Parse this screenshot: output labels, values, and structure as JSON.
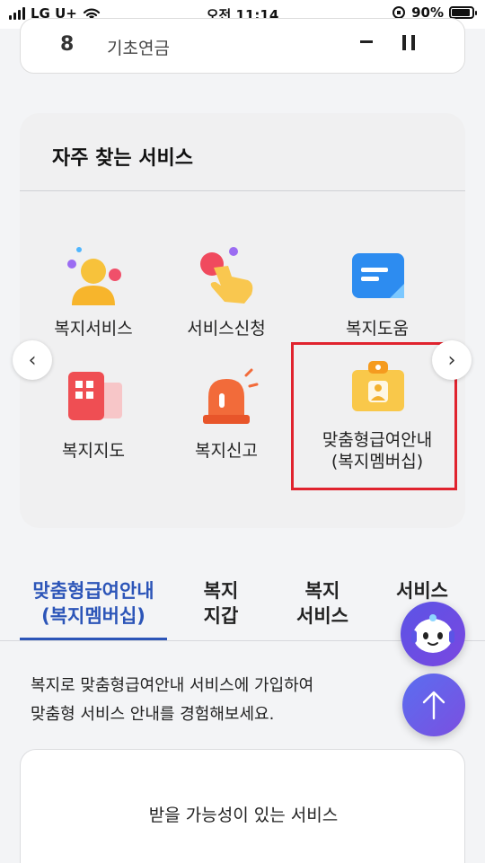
{
  "status_bar": {
    "carrier": "LG U+",
    "time": "오전 11:14",
    "battery": "90%",
    "battery_level": 0.9
  },
  "top_item": {
    "number": "8",
    "name": "기초연금"
  },
  "frequent_services": {
    "title": "자주 찾는 서비스",
    "items": [
      {
        "label": "복지서비스",
        "icon": "person-service-icon"
      },
      {
        "label": "서비스신청",
        "icon": "tap-apply-icon"
      },
      {
        "label": "복지도움",
        "icon": "chat-help-icon"
      },
      {
        "label": "복지지도",
        "icon": "map-grid-icon"
      },
      {
        "label": "복지신고",
        "icon": "siren-icon"
      },
      {
        "label": "맞춤형급여안내\n(복지멤버십)",
        "icon": "membership-badge-icon"
      }
    ]
  },
  "tabs": [
    {
      "label": "맞춤형급여안내\n(복지멤버십)",
      "active": true
    },
    {
      "label": "복지\n지갑",
      "active": false
    },
    {
      "label": "복지\n서비스",
      "active": false
    },
    {
      "label": "서비스\n신",
      "active": false
    }
  ],
  "description": "복지로 맞춤형급여안내 서비스에 가입하여\n맞춤형 서비스 안내를 경험해보세요.",
  "result_card": {
    "title": "받을 가능성이 있는 서비스"
  },
  "colors": {
    "accent": "#2c55b8",
    "highlight_border": "#e0232e",
    "fab": "#5b54e6"
  }
}
